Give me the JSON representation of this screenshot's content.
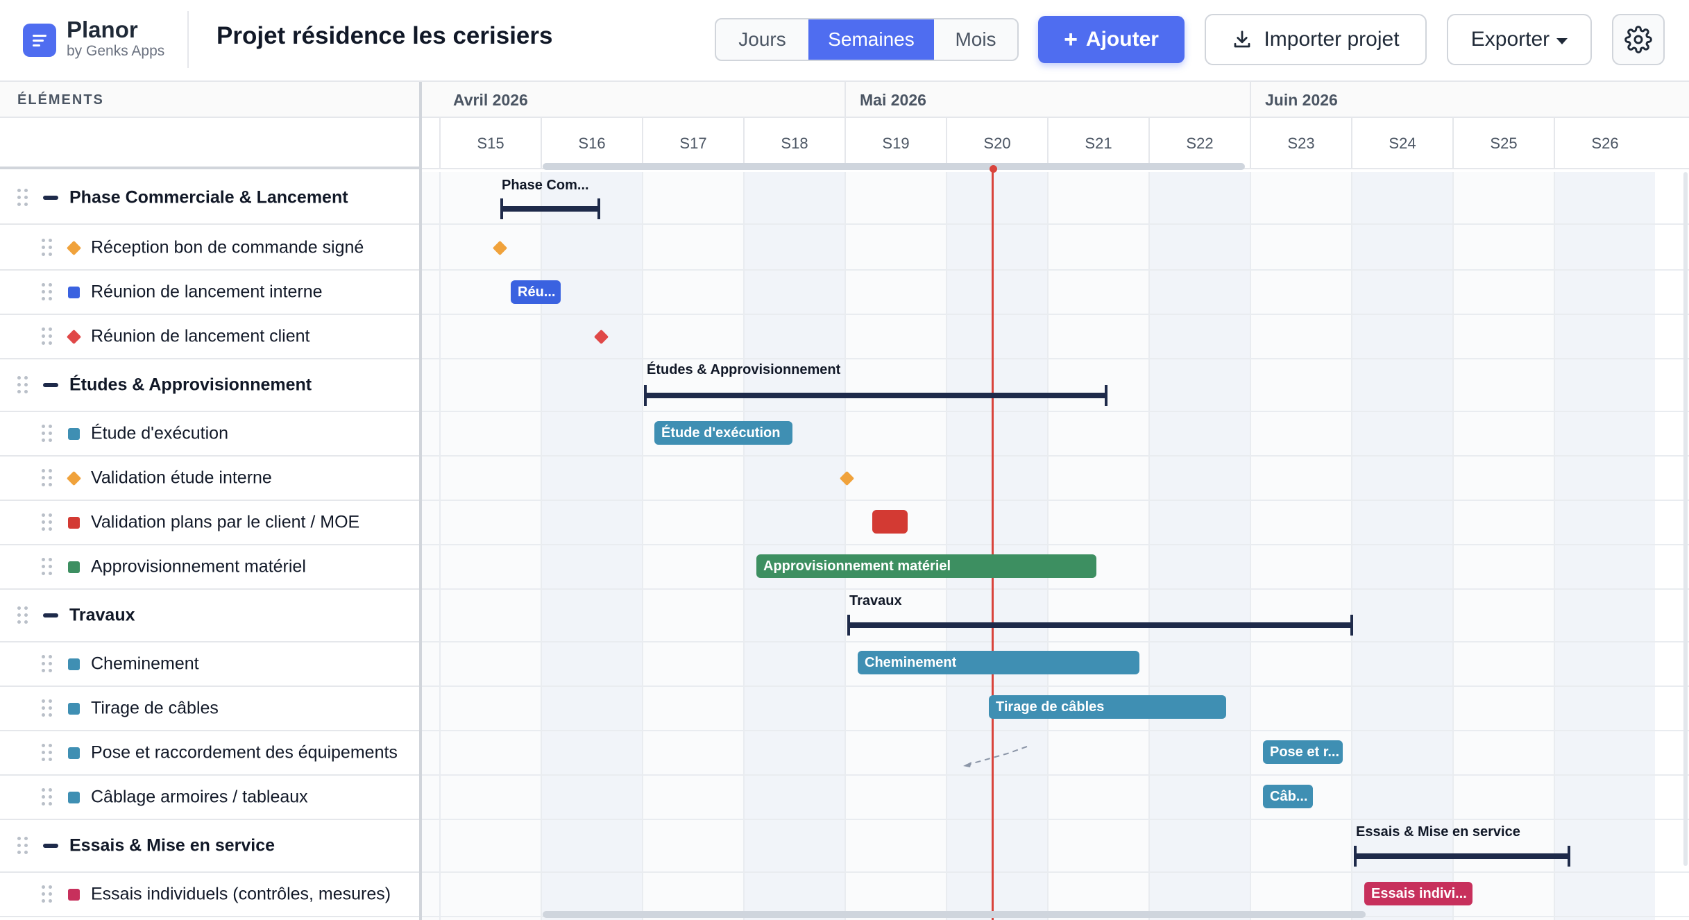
{
  "app": {
    "name": "Planor",
    "subtitle": "by Genks Apps"
  },
  "project": {
    "title": "Projet résidence les cerisiers"
  },
  "view_toggle": {
    "options": [
      "Jours",
      "Semaines",
      "Mois"
    ],
    "selected": "Semaines"
  },
  "toolbar": {
    "add_label": "Ajouter",
    "import_label": "Importer projet",
    "export_label": "Exporter"
  },
  "elements_header": "ÉLÉMENTS",
  "months": [
    "Avril 2026",
    "Mai 2026",
    "Juin 2026"
  ],
  "weeks": [
    "S15",
    "S16",
    "S17",
    "S18",
    "S19",
    "S20",
    "S21",
    "S22",
    "S23",
    "S24",
    "S25",
    "S26"
  ],
  "colors": {
    "accent": "#4f6df0",
    "summary": "#1e2a4a",
    "today": "#d9443c",
    "orange": "#f0a23b",
    "blue": "#3a62e0",
    "red": "#e04848",
    "teal": "#3f8fb3",
    "dark_red": "#d33a33",
    "green": "#3d8f61",
    "crimson": "#c7305c"
  },
  "items": [
    {
      "label": "Phase Commerciale & Lancement",
      "kind": "phase"
    },
    {
      "label": "Réception bon de commande signé",
      "kind": "milestone",
      "color": "#f0a23b"
    },
    {
      "label": "Réunion de lancement interne",
      "kind": "task",
      "color": "#3a62e0"
    },
    {
      "label": "Réunion de lancement client",
      "kind": "milestone",
      "color": "#e04848"
    },
    {
      "label": "Études & Approvisionnement",
      "kind": "phase"
    },
    {
      "label": "Étude d'exécution",
      "kind": "task",
      "color": "#3f8fb3"
    },
    {
      "label": "Validation étude interne",
      "kind": "milestone",
      "color": "#f0a23b"
    },
    {
      "label": "Validation plans par le client / MOE",
      "kind": "task",
      "color": "#d33a33"
    },
    {
      "label": "Approvisionnement matériel",
      "kind": "task",
      "color": "#3d8f61"
    },
    {
      "label": "Travaux",
      "kind": "phase"
    },
    {
      "label": "Cheminement",
      "kind": "task",
      "color": "#3f8fb3"
    },
    {
      "label": "Tirage de câbles",
      "kind": "task",
      "color": "#3f8fb3"
    },
    {
      "label": "Pose et raccordement des équipements",
      "kind": "task",
      "color": "#3f8fb3"
    },
    {
      "label": "Câblage armoires / tableaux",
      "kind": "task",
      "color": "#3f8fb3"
    },
    {
      "label": "Essais & Mise en service",
      "kind": "phase"
    },
    {
      "label": "Essais individuels (contrôles, mesures)",
      "kind": "task",
      "color": "#c7305c"
    }
  ],
  "gantt_labels": {
    "phase1": "Phase Com...",
    "task_reunion_interne": "Réu...",
    "phase2": "Études & Approvisionnement",
    "task_etude": "Étude d'exécution",
    "task_appro": "Approvisionnement matériel",
    "phase3": "Travaux",
    "task_cheminement": "Cheminement",
    "task_tirage": "Tirage de câbles",
    "task_pose": "Pose et r...",
    "task_cablage": "Câb...",
    "phase4": "Essais & Mise en service",
    "task_essais": "Essais indivi..."
  }
}
